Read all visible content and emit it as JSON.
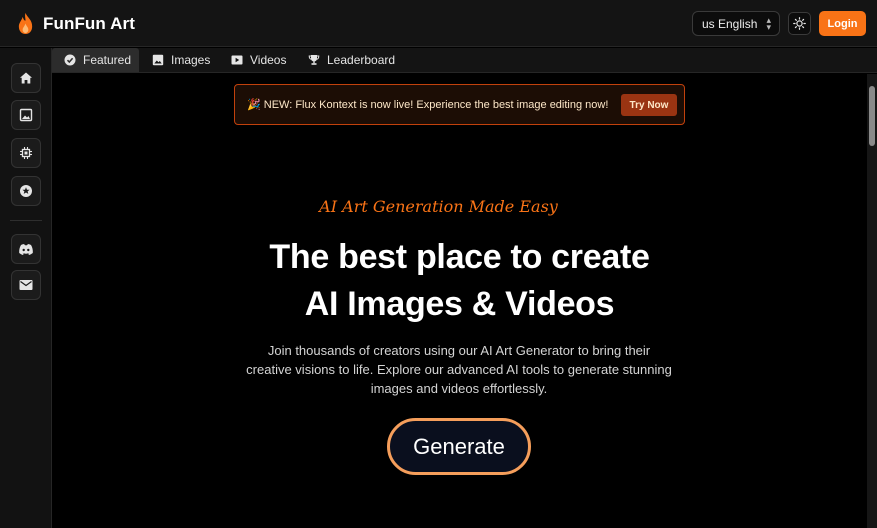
{
  "app": {
    "name": "FunFun Art",
    "logo_icon": "flame-icon",
    "accent": "#f97316"
  },
  "header": {
    "language": {
      "flag": "us",
      "label": "English",
      "value": "us English"
    },
    "theme_icon": "sun-icon",
    "login_label": "Login"
  },
  "sidebar": {
    "items": [
      {
        "icon": "home-icon"
      },
      {
        "icon": "image-icon"
      },
      {
        "icon": "chip-icon"
      },
      {
        "icon": "star-icon"
      },
      {
        "icon": "discord-icon"
      },
      {
        "icon": "mail-icon"
      }
    ]
  },
  "tabs": [
    {
      "label": "Featured",
      "icon": "check-badge-icon",
      "active": true
    },
    {
      "label": "Images",
      "icon": "image-icon",
      "active": false
    },
    {
      "label": "Videos",
      "icon": "video-icon",
      "active": false
    },
    {
      "label": "Leaderboard",
      "icon": "trophy-icon",
      "active": false
    }
  ],
  "banner": {
    "emoji": "🎉",
    "text": "NEW: Flux Kontext is now live! Experience the best image editing now!",
    "cta": "Try Now"
  },
  "hero": {
    "tagline": "AI Art Generation Made Easy",
    "headline_line1": "The best place to create",
    "headline_line2": "AI Images & Videos",
    "description": "Join thousands of creators using our AI Art Generator to bring their creative visions to life. Explore our advanced AI tools to generate stunning images and videos effortlessly.",
    "cta": "Generate"
  }
}
